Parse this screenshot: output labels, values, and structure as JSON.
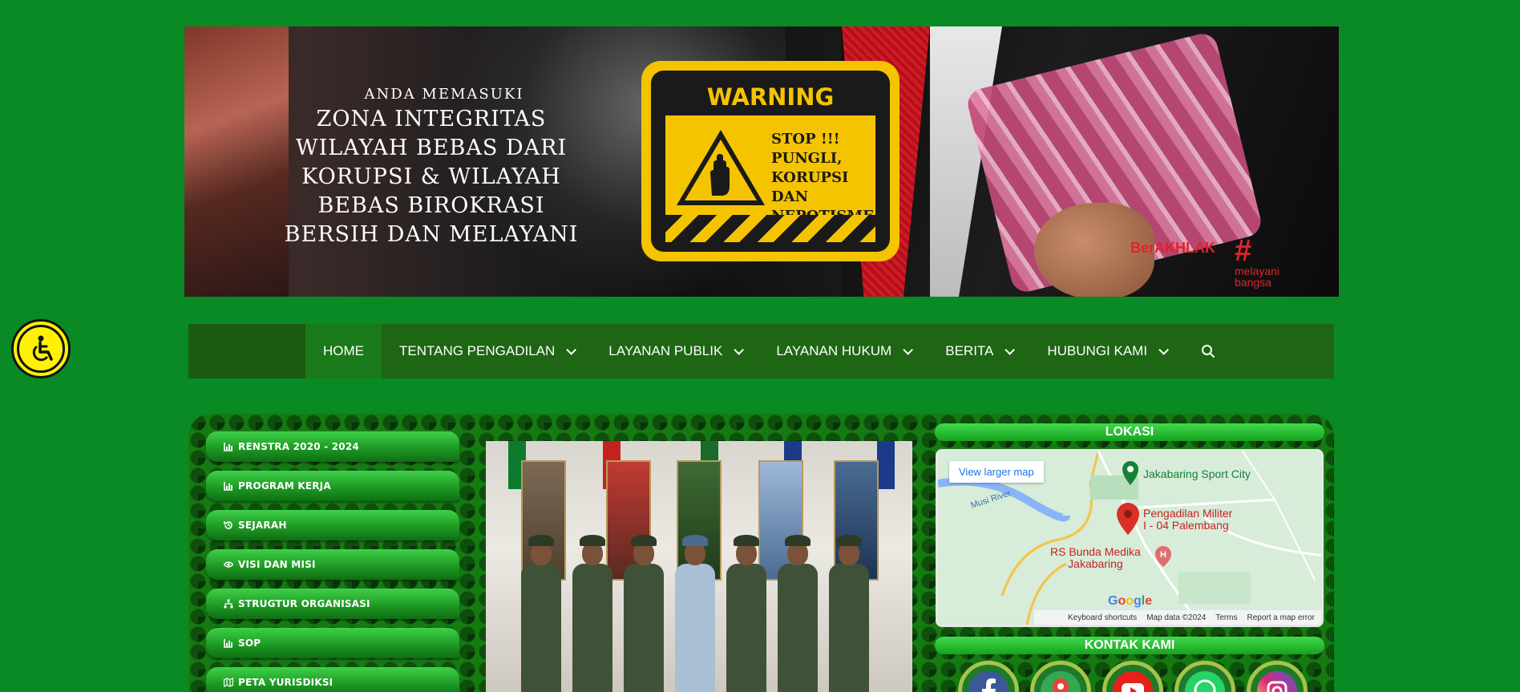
{
  "banner": {
    "intro": "ANDA MEMASUKI",
    "lines": [
      "ZONA INTEGRITAS",
      "WILAYAH BEBAS DARI",
      "KORUPSI & WILAYAH",
      "BEBAS BIROKRASI",
      "BERSIH DAN MELAYANI"
    ],
    "warning_title": "WARNING",
    "warning_lines": [
      "STOP !!!",
      "PUNGLI,",
      "KORUPSI DAN",
      "NEPOTISME !"
    ],
    "berakhlak": "BerAKHLAK",
    "melayani_hash": "#",
    "melayani_lines": [
      "melayani",
      "bangsa"
    ]
  },
  "nav": {
    "items": [
      {
        "label": "HOME",
        "active": true,
        "dropdown": false
      },
      {
        "label": "TENTANG PENGADILAN",
        "dropdown": true
      },
      {
        "label": "LAYANAN PUBLIK",
        "dropdown": true
      },
      {
        "label": "LAYANAN HUKUM",
        "dropdown": true
      },
      {
        "label": "BERITA",
        "dropdown": true
      },
      {
        "label": "HUBUNGI KAMI",
        "dropdown": true
      }
    ],
    "search_icon": "search-icon"
  },
  "side_menu": [
    {
      "label": "RENSTRA 2020 - 2024",
      "icon": "chart-icon"
    },
    {
      "label": "PROGRAM KERJA",
      "icon": "chart-icon"
    },
    {
      "label": "SEJARAH",
      "icon": "history-icon"
    },
    {
      "label": "VISI DAN MISI",
      "icon": "eye-icon"
    },
    {
      "label": "STRUGTUR ORGANISASI",
      "icon": "sitemap-icon"
    },
    {
      "label": "SOP",
      "icon": "chart-icon"
    },
    {
      "label": "PETA YURISDIKSI",
      "icon": "map-icon"
    }
  ],
  "lokasi": {
    "title": "LOKASI",
    "map_button": "View larger map",
    "labels": {
      "sport": "Jakabaring Sport City",
      "river": "Musi River",
      "court_l1": "Pengadilan Militer",
      "court_l2": "I - 04 Palembang",
      "hospital_l1": "RS Bunda Medika",
      "hospital_l2": "Jakabaring"
    },
    "footer": [
      "Keyboard shortcuts",
      "Map data ©2024",
      "Terms",
      "Report a map error"
    ],
    "google": "Google"
  },
  "kontak": {
    "title": "KONTAK KAMI",
    "icons": [
      "facebook-icon",
      "maps-icon",
      "youtube-icon",
      "whatsapp-icon",
      "instagram-icon"
    ]
  },
  "colors": {
    "page_bg": "#0a8a24",
    "nav_bg": "#1e6614",
    "accent_yellow": "#f5c400"
  }
}
